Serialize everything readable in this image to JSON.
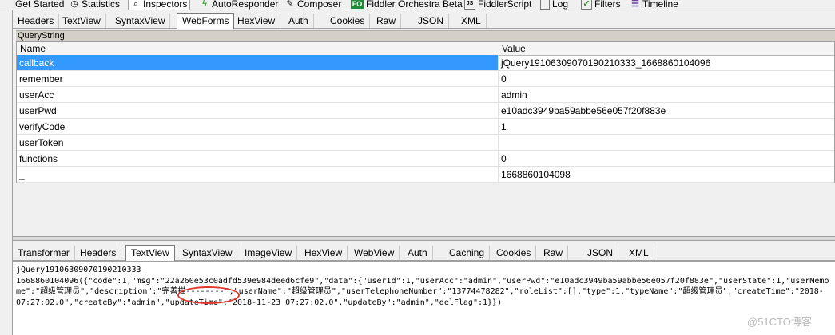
{
  "top_tabs": [
    {
      "label": "Get Started",
      "icon": "get-started-icon"
    },
    {
      "label": "Statistics",
      "icon": "timer-icon"
    },
    {
      "label": "Inspectors",
      "icon": "magnifier-icon"
    },
    {
      "label": "AutoResponder",
      "icon": "lightning-icon"
    },
    {
      "label": "Composer",
      "icon": "pencil-icon"
    },
    {
      "label": "Fiddler Orchestra Beta",
      "icon": "fo-icon",
      "icon_text": "FO"
    },
    {
      "label": "FiddlerScript",
      "icon": "js-icon",
      "icon_text": "JS"
    },
    {
      "label": "Log",
      "icon": "log-icon"
    },
    {
      "label": "Filters",
      "icon": "checkbox-icon"
    },
    {
      "label": "Timeline",
      "icon": "timeline-icon"
    }
  ],
  "request_tabs": [
    "Headers",
    "TextView",
    "SyntaxView",
    "WebForms",
    "HexView",
    "Auth",
    "Cookies",
    "Raw",
    "JSON",
    "XML"
  ],
  "request_selected": "WebForms",
  "querystring": {
    "label": "QueryString",
    "columns": [
      "Name",
      "Value"
    ],
    "rows": [
      {
        "name": "callback",
        "value": "jQuery19106309070190210333_1668860104096",
        "selected": true
      },
      {
        "name": "remember",
        "value": "0"
      },
      {
        "name": "userAcc",
        "value": "admin"
      },
      {
        "name": "userPwd",
        "value": "e10adc3949ba59abbe56e057f20f883e"
      },
      {
        "name": "verifyCode",
        "value": "1"
      },
      {
        "name": "userToken",
        "value": ""
      },
      {
        "name": "functions",
        "value": "0"
      },
      {
        "name": "_",
        "value": "1668860104098"
      }
    ]
  },
  "response_tabs": [
    "Transformer",
    "Headers",
    "TextView",
    "SyntaxView",
    "ImageView",
    "HexView",
    "WebView",
    "Auth",
    "Caching",
    "Cookies",
    "Raw",
    "JSON",
    "XML"
  ],
  "response_selected": "TextView",
  "response_text": [
    "jQuery19106309070190210333_",
    "1668860104096({\"code\":1,\"msg\":\"22a260e53c0adfd539e984deed6cfe9\",\"data\":{\"userId\":1,\"userAcc\":\"admin\",\"userPwd\":\"e10adc3949ba59abbe56e057f20f883e\",\"userState\":1,\"userMemo",
    "me\":\"超级管理员\",\"description\":\"完善描--------\",\"userName\":\"超级管理员\",\"userTelephoneNumber\":\"13774478282\",\"roleList\":[],\"type\":1,\"typeName\":\"超级管理员\",\"createTime\":\"2018-",
    "07:27:02.0\",\"createBy\":\"admin\",\"updateTime\":\"2018-11-23 07:27:02.0\",\"updateBy\":\"admin\",\"delFlag\":1}})"
  ],
  "watermark": "@51CTO博客"
}
